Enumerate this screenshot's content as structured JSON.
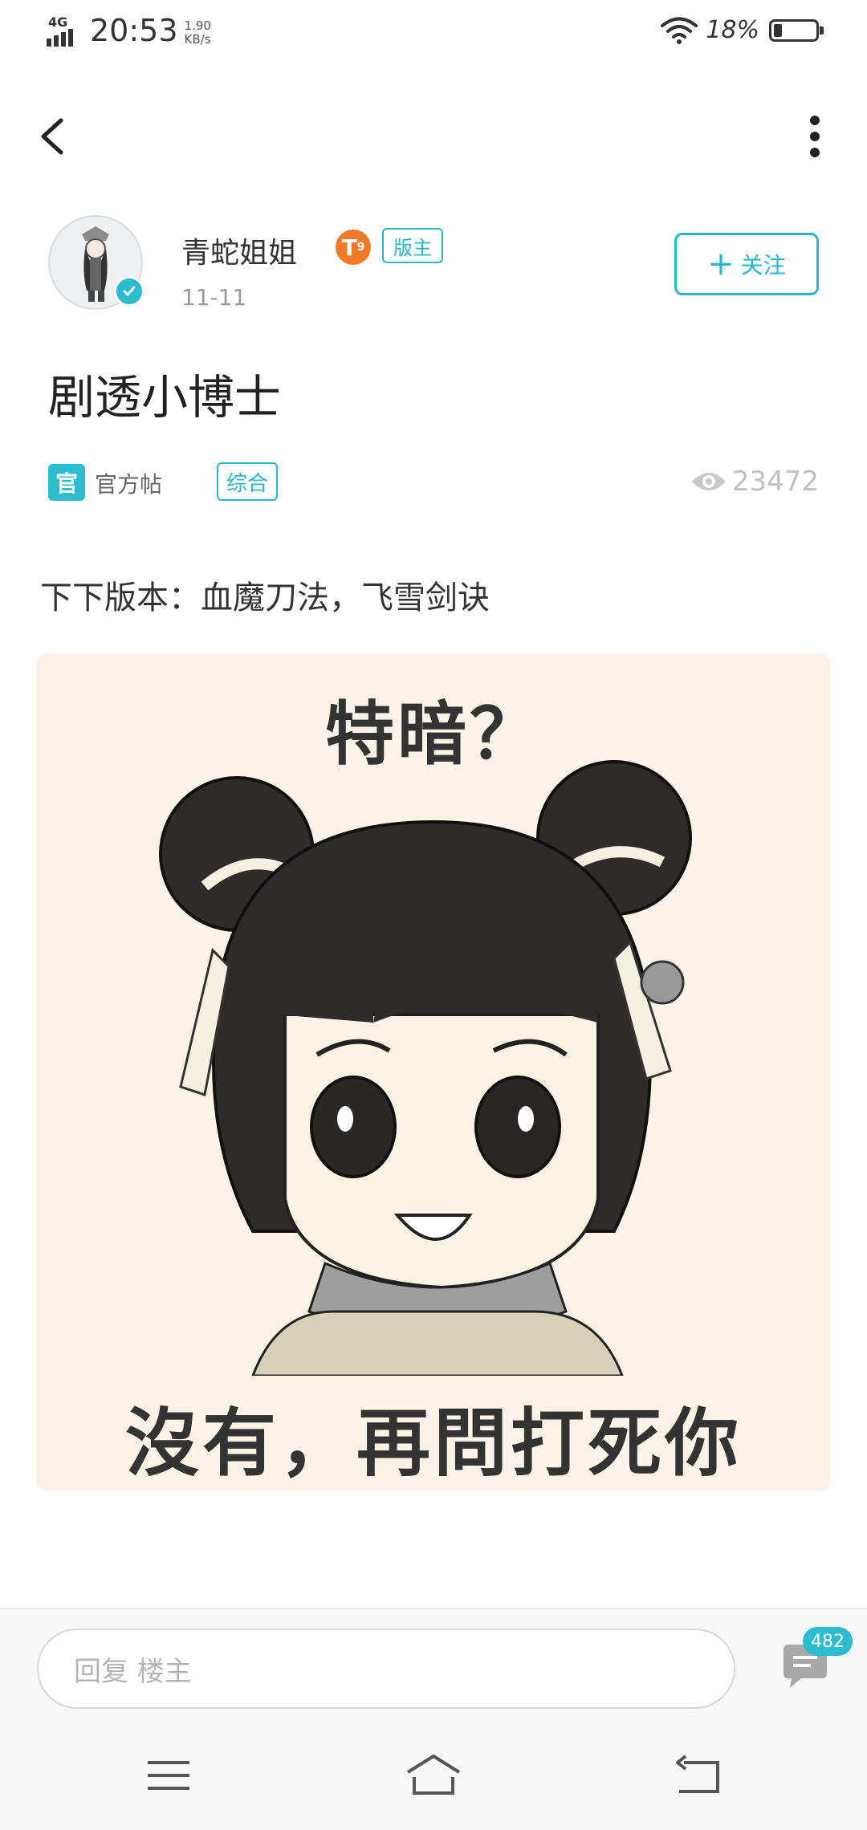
{
  "status_bar": {
    "network": "4G",
    "time": "20:53",
    "speed_value": "1.90",
    "speed_unit": "KB/s",
    "battery_percent": "18%"
  },
  "topbar": {
    "back_icon": "back-arrow-icon",
    "more_icon": "more-vertical-icon"
  },
  "author": {
    "name": "青蛇姐姐",
    "level": "T",
    "level_sub": "9",
    "role_badge": "版主",
    "date": "11-11",
    "follow_label": "关注"
  },
  "post": {
    "title": "剧透小博士",
    "official_icon": "官",
    "official_label": "官方帖",
    "category": "综合",
    "views": "23472",
    "body": "下下版本：血魔刀法，飞雪剑诀",
    "image": {
      "top_text": "特暗？",
      "bottom_text": "沒有，再問打死你"
    }
  },
  "reply": {
    "placeholder": "回复  楼主",
    "comment_count": "482"
  },
  "nav": {
    "menu_icon": "menu-icon",
    "home_icon": "home-icon",
    "back_icon": "back-icon"
  },
  "colors": {
    "accent": "#2bb5c9",
    "level_badge": "#f07a2a",
    "image_bg": "#fbf4e6"
  }
}
